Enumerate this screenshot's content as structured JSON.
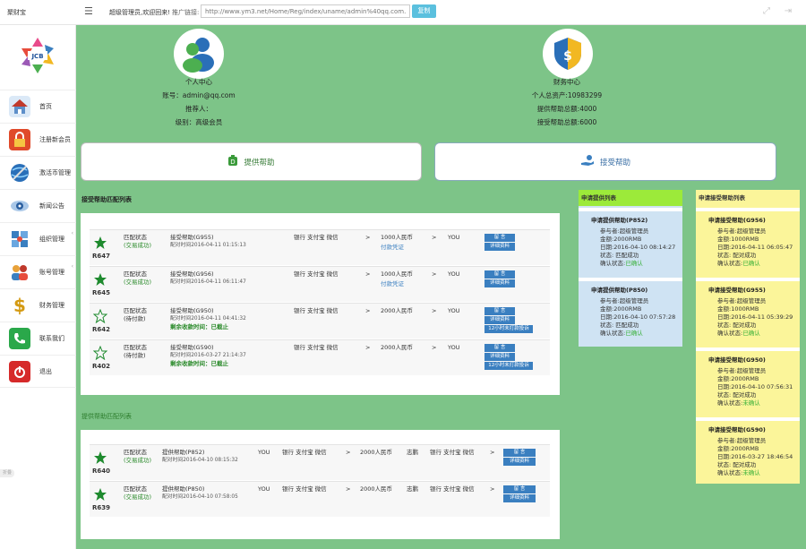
{
  "header": {
    "brand": "聚财宝",
    "menu_icon": "hamburger-icon",
    "welcome": "超级管理员,欢迎回来!",
    "promo_label": "推广链接:",
    "promo_url": "http://www.ym3.net/Home/Reg/index/uname/admin%40qq.com.html",
    "copy_label": "复制"
  },
  "sidebar": {
    "items": [
      {
        "label": "首页",
        "icon": "home-icon",
        "arrow": false
      },
      {
        "label": "注册新会员",
        "icon": "lock-icon",
        "arrow": false
      },
      {
        "label": "激活币管理",
        "icon": "globe-icon",
        "arrow": false
      },
      {
        "label": "新闻公告",
        "icon": "eye-icon",
        "arrow": false
      },
      {
        "label": "组织管理",
        "icon": "network-icon",
        "arrow": true
      },
      {
        "label": "账号管理",
        "icon": "users-icon",
        "arrow": true
      },
      {
        "label": "财务管理",
        "icon": "dollar-icon",
        "arrow": false
      },
      {
        "label": "联系我们",
        "icon": "phone-icon",
        "arrow": false
      },
      {
        "label": "退出",
        "icon": "power-icon",
        "arrow": false
      }
    ],
    "tag": "折叠"
  },
  "personal": {
    "title": "个人中心",
    "account": "账号：admin@qq.com",
    "referrer": "推荐人：",
    "level": "级别：高级会员"
  },
  "finance": {
    "title": "财务中心",
    "total_assets": "个人总资产:10983299",
    "provide_total": "提供帮助总额:4000",
    "receive_total": "接受帮助总额:6000"
  },
  "actions": {
    "provide": "提供帮助",
    "receive": "接受帮助"
  },
  "receive_match": {
    "title": "接受帮助匹配列表",
    "rows": [
      {
        "id": "R647",
        "star": "filled",
        "status": "匹配状态",
        "sub": "(交易成功)",
        "sub_color": "green",
        "help": "接受帮助(G955)",
        "time": "配对时间2016-04-11 01:15:13",
        "note": "",
        "pay": "银行 支付宝 微信",
        "amount": "1000人民币",
        "extra": "付款凭证",
        "you": "YOU",
        "btns": [
          "留 言",
          "详细资料"
        ]
      },
      {
        "id": "R645",
        "star": "filled",
        "status": "匹配状态",
        "sub": "(交易成功)",
        "sub_color": "green",
        "help": "接受帮助(G956)",
        "time": "配对时间2016-04-11 06:11:47",
        "note": "",
        "pay": "银行 支付宝 微信",
        "amount": "1000人民币",
        "extra": "付款凭证",
        "you": "YOU",
        "btns": [
          "留 言",
          "详细资料"
        ]
      },
      {
        "id": "R642",
        "star": "outline",
        "status": "匹配状态",
        "sub": "(待付款)",
        "sub_color": "dark",
        "help": "接受帮助(G950)",
        "time": "配对时间2016-04-11 04:41:32",
        "note": "剩余收款时间：已截止",
        "pay": "银行 支付宝 微信",
        "amount": "2000人民币",
        "extra": "",
        "you": "YOU",
        "btns": [
          "留 言",
          "详细资料",
          "12小时未打款投诉"
        ]
      },
      {
        "id": "R402",
        "star": "outline",
        "status": "匹配状态",
        "sub": "(待付款)",
        "sub_color": "dark",
        "help": "接受帮助(G590)",
        "time": "配对时间2016-03-27 21:14:37",
        "note": "剩余收款时间：已截止",
        "pay": "银行 支付宝 微信",
        "amount": "2000人民币",
        "extra": "",
        "you": "YOU",
        "btns": [
          "留 言",
          "详细资料",
          "12小时未打款投诉"
        ]
      }
    ]
  },
  "provide_match": {
    "title": "提供帮助匹配列表",
    "rows": [
      {
        "id": "R640",
        "star": "filled",
        "status": "匹配状态",
        "sub": "(交易成功)",
        "help": "提供帮助(P852)",
        "time": "配对时间2016-04-10 08:15:32",
        "you": "YOU",
        "pay": "银行 支付宝 微信",
        "amount": "2000人民币",
        "to": "志鹏",
        "pay2": "银行 支付宝 微信",
        "btns": [
          "留 言",
          "详细资料"
        ]
      },
      {
        "id": "R639",
        "star": "filled",
        "status": "匹配状态",
        "sub": "(交易成功)",
        "help": "提供帮助(P850)",
        "time": "配对时间2016-04-10 07:58:05",
        "you": "YOU",
        "pay": "银行 支付宝 微信",
        "amount": "2000人民币",
        "to": "志鹏",
        "pay2": "银行 支付宝 微信",
        "btns": [
          "留 言",
          "详细资料"
        ]
      }
    ]
  },
  "provide_list": {
    "title": "申请提供列表",
    "cards": [
      {
        "title": "申请提供帮助(P852)",
        "participant": "参与者:超级管理员",
        "amount": "金额:2000RMB",
        "date": "日期:2016-04-10 08:14:27",
        "state": "状态: 匹配成功",
        "confirm_label": "确认状态:",
        "confirm": "已确认"
      },
      {
        "title": "申请提供帮助(P850)",
        "participant": "参与者:超级管理员",
        "amount": "金额:2000RMB",
        "date": "日期:2016-04-10 07:57:28",
        "state": "状态: 匹配成功",
        "confirm_label": "确认状态:",
        "confirm": "已确认"
      }
    ]
  },
  "receive_list": {
    "title": "申请接受帮助列表",
    "cards": [
      {
        "title": "申请接受帮助(G956)",
        "participant": "参与者:超级管理员",
        "amount": "金额:1000RMB",
        "date": "日期:2016-04-11 06:05:47",
        "state": "状态: 配对成功",
        "confirm_label": "确认状态:",
        "confirm": "已确认"
      },
      {
        "title": "申请接受帮助(G955)",
        "participant": "参与者:超级管理员",
        "amount": "金额:1000RMB",
        "date": "日期:2016-04-11 05:39:29",
        "state": "状态: 配对成功",
        "confirm_label": "确认状态:",
        "confirm": "已确认"
      },
      {
        "title": "申请接受帮助(G950)",
        "participant": "参与者:超级管理员",
        "amount": "金额:2000RMB",
        "date": "日期:2016-04-10 07:56:31",
        "state": "状态: 配对成功",
        "confirm_label": "确认状态:",
        "confirm": "未确认"
      },
      {
        "title": "申请接受帮助(G590)",
        "participant": "参与者:超级管理员",
        "amount": "金额:2000RMB",
        "date": "日期:2016-03-27 18:46:54",
        "state": "状态: 配对成功",
        "confirm_label": "确认状态:",
        "confirm": "未确认"
      }
    ]
  },
  "colors": {
    "background": "#7dc488",
    "provide_head": "#9cea3a",
    "provide_card": "#cfe3f3",
    "receive_card": "#fbf59a",
    "button_blue": "#3a7fc0",
    "copy_button": "#5bc0de"
  }
}
